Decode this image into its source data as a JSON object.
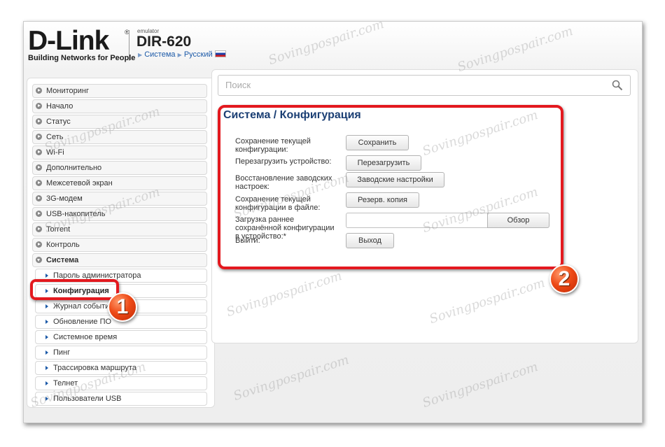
{
  "header": {
    "brand": "D-Link",
    "brand_reg": "®",
    "tagline": "Building Networks for People",
    "emulator_label": "emulator",
    "model": "DIR-620",
    "crumb_system": "Система",
    "crumb_lang": "Русский"
  },
  "search": {
    "placeholder": "Поиск"
  },
  "menu": {
    "items": [
      {
        "label": "Мониторинг"
      },
      {
        "label": "Начало"
      },
      {
        "label": "Статус"
      },
      {
        "label": "Сеть"
      },
      {
        "label": "Wi-Fi"
      },
      {
        "label": "Дополнительно"
      },
      {
        "label": "Межсетевой экран"
      },
      {
        "label": "3G-модем"
      },
      {
        "label": "USB-накопитель"
      },
      {
        "label": "Torrent"
      },
      {
        "label": "Контроль"
      },
      {
        "label": "Система"
      }
    ],
    "subitems": [
      {
        "label": "Пароль администратора"
      },
      {
        "label": "Конфигурация"
      },
      {
        "label": "Журнал событий"
      },
      {
        "label": "Обновление ПО"
      },
      {
        "label": "Системное время"
      },
      {
        "label": "Пинг"
      },
      {
        "label": "Трассировка маршрута"
      },
      {
        "label": "Телнет"
      },
      {
        "label": "Пользователи USB"
      }
    ]
  },
  "page": {
    "title": "Система /  Конфигурация",
    "rows": [
      {
        "label": "Сохранение текущей конфигурации:",
        "button": "Сохранить"
      },
      {
        "label": "Перезагрузить устройство:",
        "button": "Перезагрузить"
      },
      {
        "label": "Восстановление заводских настроек:",
        "button": "Заводские настройки"
      },
      {
        "label": "Сохранение текущей конфигурации в файле:",
        "button": "Резерв. копия"
      },
      {
        "label": "Загрузка раннее сохранённой конфигурации в устройство:*",
        "button": "Обзор"
      },
      {
        "label": "Выйти:",
        "button": "Выход"
      }
    ]
  },
  "annotations": {
    "badge1": "1",
    "badge2": "2",
    "highlight_color": "#e3191f"
  },
  "watermark": "Sovingpospair.com"
}
